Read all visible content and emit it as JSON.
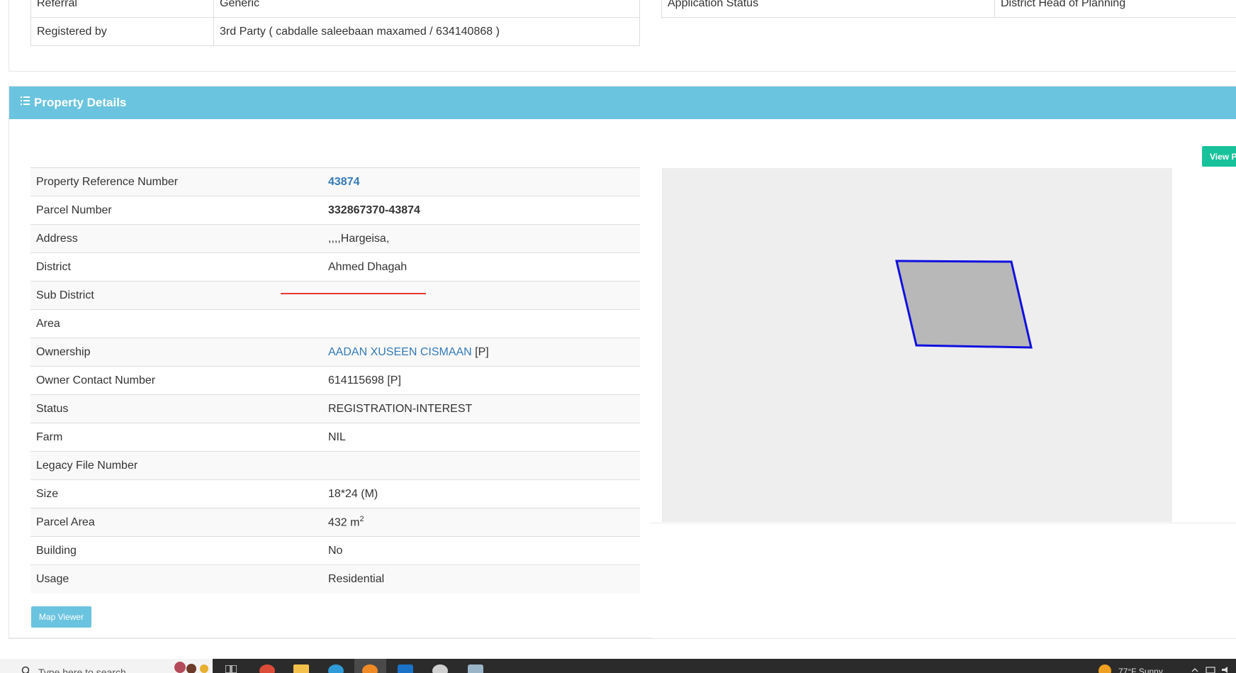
{
  "top": {
    "rows": [
      {
        "key": "Referral",
        "value": "Generic"
      },
      {
        "key": "Registered by",
        "value": "3rd Party ( cabdalle saleebaan maxamed / 634140868 )"
      }
    ],
    "right_rows": [
      {
        "key": "Application Status",
        "value": "District Head of Planning"
      }
    ]
  },
  "panel": {
    "title": "Property Details",
    "view_button": "View P",
    "map_viewer_button": "Map Viewer"
  },
  "details": [
    {
      "key": "Property Reference Number",
      "value": "43874"
    },
    {
      "key": "Parcel Number",
      "value": "332867370-43874"
    },
    {
      "key": "Address",
      "value": ",,,,Hargeisa,"
    },
    {
      "key": "District",
      "value": "Ahmed Dhagah"
    },
    {
      "key": "Sub District",
      "value": ""
    },
    {
      "key": "Area",
      "value": ""
    },
    {
      "key": "Ownership",
      "value": "AADAN XUSEEN CISMAAN",
      "suffix": " [P]"
    },
    {
      "key": "Owner Contact Number",
      "value": "614115698 [P]"
    },
    {
      "key": "Status",
      "value": "REGISTRATION-INTEREST"
    },
    {
      "key": "Farm",
      "value": "NIL"
    },
    {
      "key": "Legacy File Number",
      "value": ""
    },
    {
      "key": "Size",
      "value": "18*24 (M)"
    },
    {
      "key": "Parcel Area",
      "value": "432 m",
      "sup": "2"
    },
    {
      "key": "Building",
      "value": "No"
    },
    {
      "key": "Usage",
      "value": "Residential"
    }
  ],
  "map": {
    "fill_color": "#b8b8b8",
    "stroke_color": "#1010e0",
    "background_color": "#eeeeee"
  },
  "taskbar": {
    "search_placeholder": "Type here to search",
    "tray_text": "77°F  Sunny"
  },
  "colors": {
    "heading": "#6bc4df",
    "link": "#337ab7",
    "view_button": "#17c29a"
  }
}
